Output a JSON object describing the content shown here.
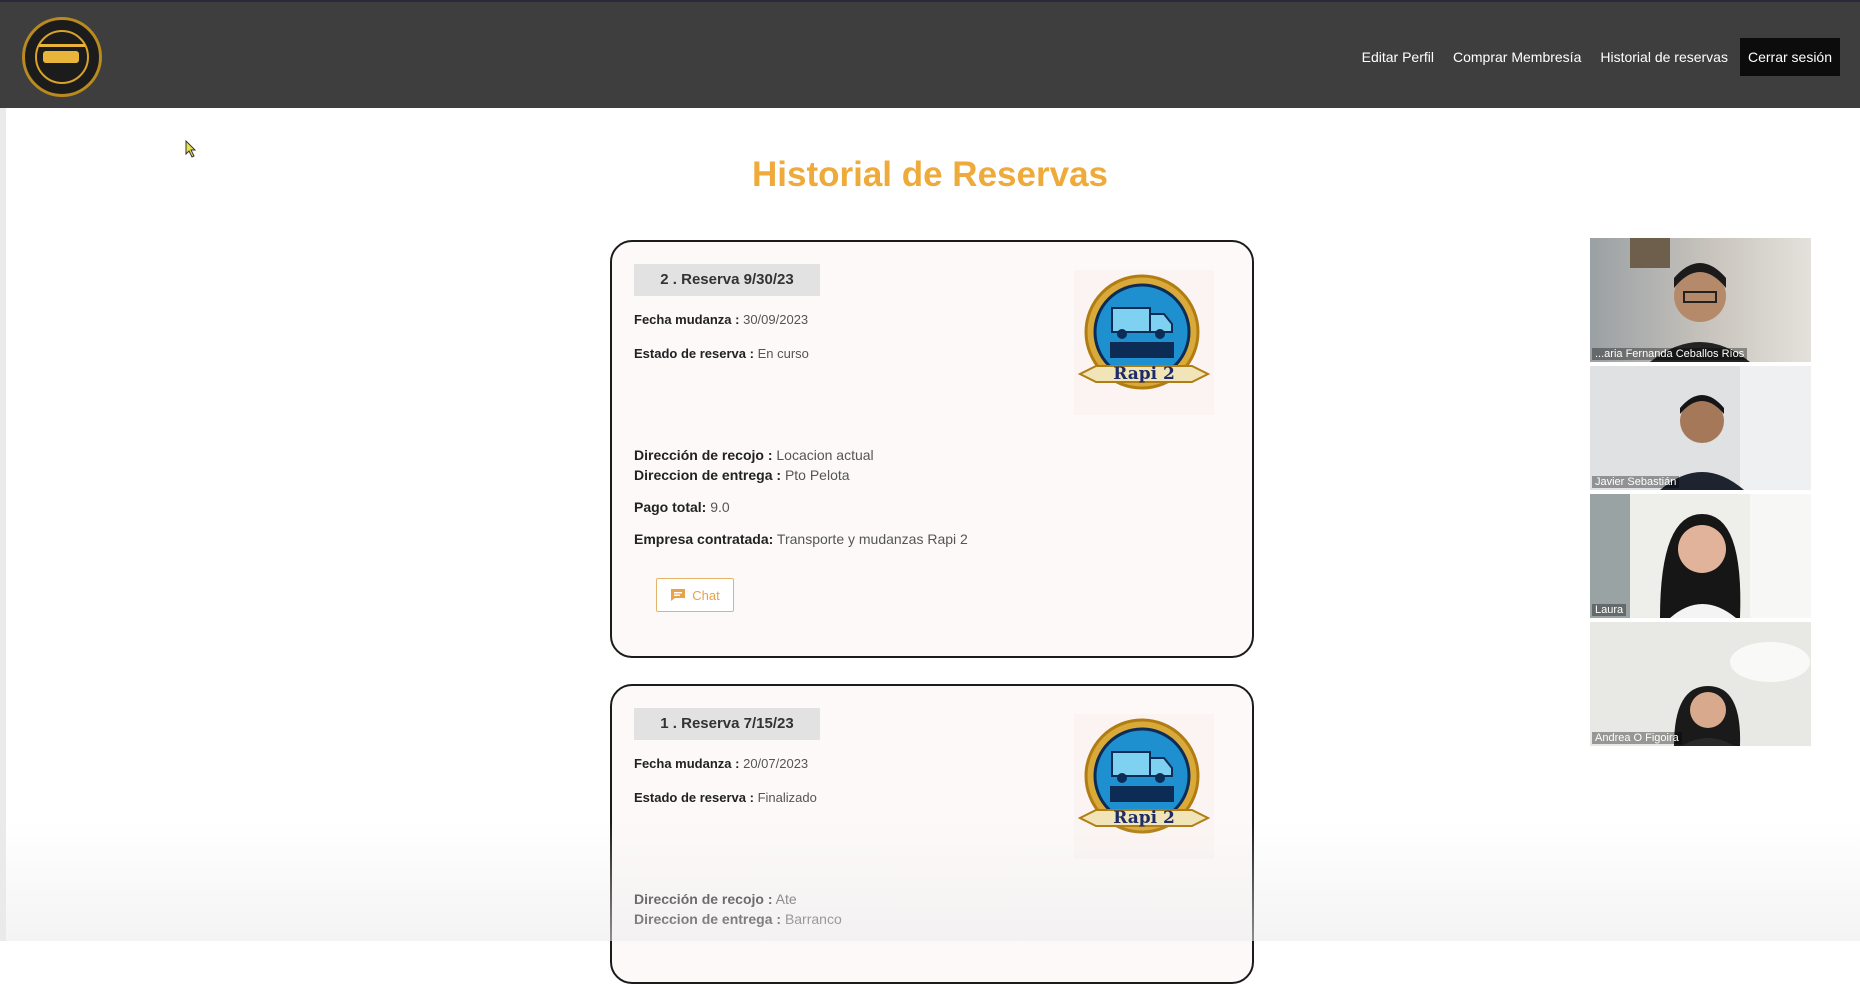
{
  "nav": {
    "links": [
      "Editar Perfil",
      "Comprar Membresía",
      "Historial de reservas"
    ],
    "logout": "Cerrar sesión"
  },
  "page_title": "Historial de Reservas",
  "reservations": [
    {
      "header": "2 . Reserva 9/30/23",
      "fecha_label": "Fecha mudanza :",
      "fecha_value": "30/09/2023",
      "estado_label": "Estado de reserva :",
      "estado_value": "En curso",
      "recojo_label": "Dirección de recojo :",
      "recojo_value": "Locacion actual",
      "entrega_label": "Direccion de entrega :",
      "entrega_value": "Pto Pelota",
      "pago_label": "Pago total:",
      "pago_value": "9.0",
      "empresa_label": "Empresa contratada:",
      "empresa_value": "Transporte y mudanzas Rapi 2",
      "chat_label": "Chat",
      "badge_brand": "Rapi 2"
    },
    {
      "header": "1 . Reserva 7/15/23",
      "fecha_label": "Fecha mudanza :",
      "fecha_value": "20/07/2023",
      "estado_label": "Estado de reserva :",
      "estado_value": "Finalizado",
      "recojo_label": "Dirección de recojo :",
      "recojo_value": "Ate",
      "entrega_label": "Direccion de entrega :",
      "entrega_value": "Barranco",
      "badge_brand": "Rapi 2"
    }
  ],
  "participants": [
    "...aria Fernanda Ceballos Ríos",
    "Javier Sebastián",
    "Laura",
    "Andrea O Figoira"
  ],
  "colors": {
    "navbar": "#3e3e3e",
    "title": "#eeaa3a",
    "accent": "#e8a24a"
  }
}
